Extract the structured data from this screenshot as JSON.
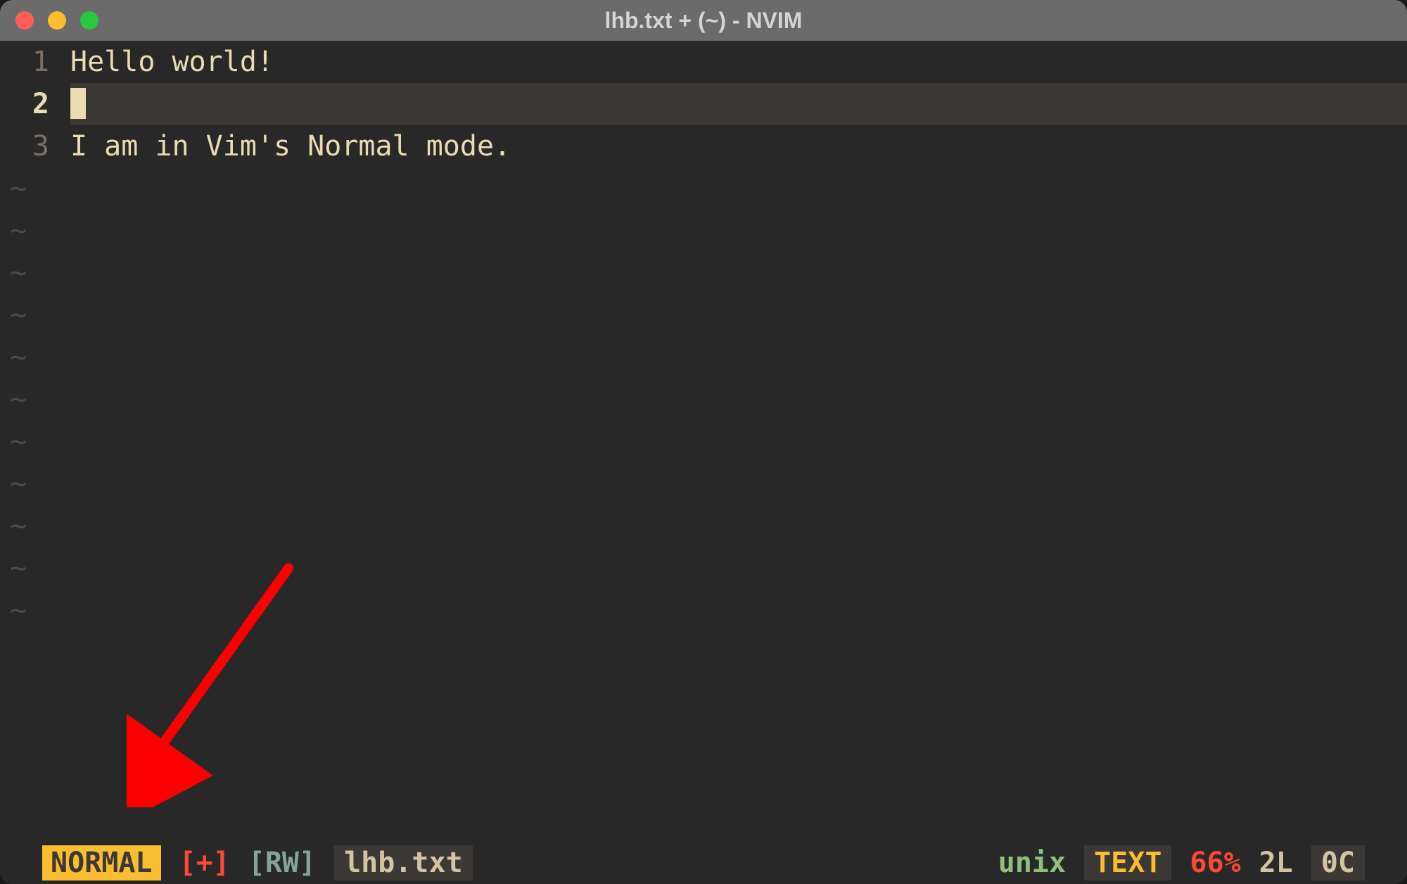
{
  "window": {
    "title": "lhb.txt + (~) - NVIM"
  },
  "buffer": {
    "lines": [
      {
        "num": "1",
        "text": "Hello world!",
        "current": false
      },
      {
        "num": "2",
        "text": "",
        "current": true
      },
      {
        "num": "3",
        "text": "I am in Vim's Normal mode.",
        "current": false
      }
    ],
    "tilde": "~",
    "tilde_count": 11
  },
  "status": {
    "mode": "NORMAL",
    "modified": "[+]",
    "readwrite": "[RW]",
    "filename": "lhb.txt",
    "fileformat": "unix",
    "filetype": "TEXT",
    "percent": "66%",
    "line": "2L",
    "col": "0C"
  }
}
